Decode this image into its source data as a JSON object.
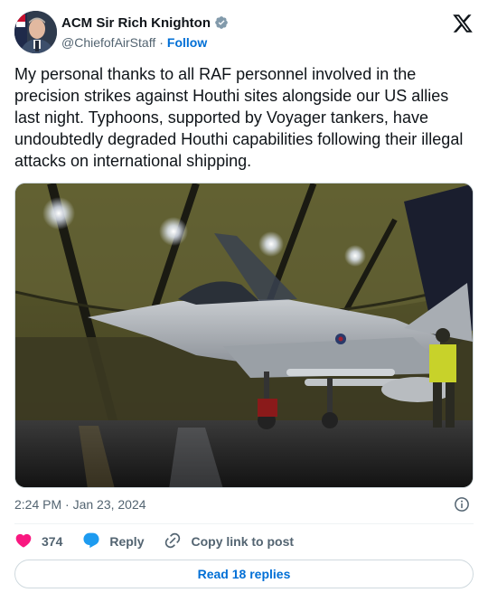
{
  "author": {
    "name": "ACM Sir Rich Knighton",
    "handle": "@ChiefofAirStaff",
    "follow_label": "Follow",
    "separator": "·"
  },
  "tweet": {
    "text": "My personal thanks to all RAF personnel involved in the precision strikes against Houthi sites alongside our US allies last night. Typhoons, supported by Voyager tankers, have undoubtedly degraded Houthi capabilities following their illegal attacks on international shipping.",
    "timestamp": "2:24 PM · Jan 23, 2024"
  },
  "stats": {
    "likes": "374",
    "reply_label": "Reply",
    "copy_link_label": "Copy link to post"
  },
  "read_replies_label": "Read 18 replies",
  "icons": {
    "verified": "verified-badge-icon",
    "x_logo": "x-logo-icon",
    "info": "info-icon",
    "heart": "heart-icon",
    "reply": "reply-bubble-icon",
    "link": "link-icon"
  },
  "colors": {
    "link_blue": "#006fd6",
    "heart_red": "#f91880",
    "reply_blue": "#1d9bf0",
    "secondary_text": "#536471",
    "primary_text": "#0f1419"
  }
}
